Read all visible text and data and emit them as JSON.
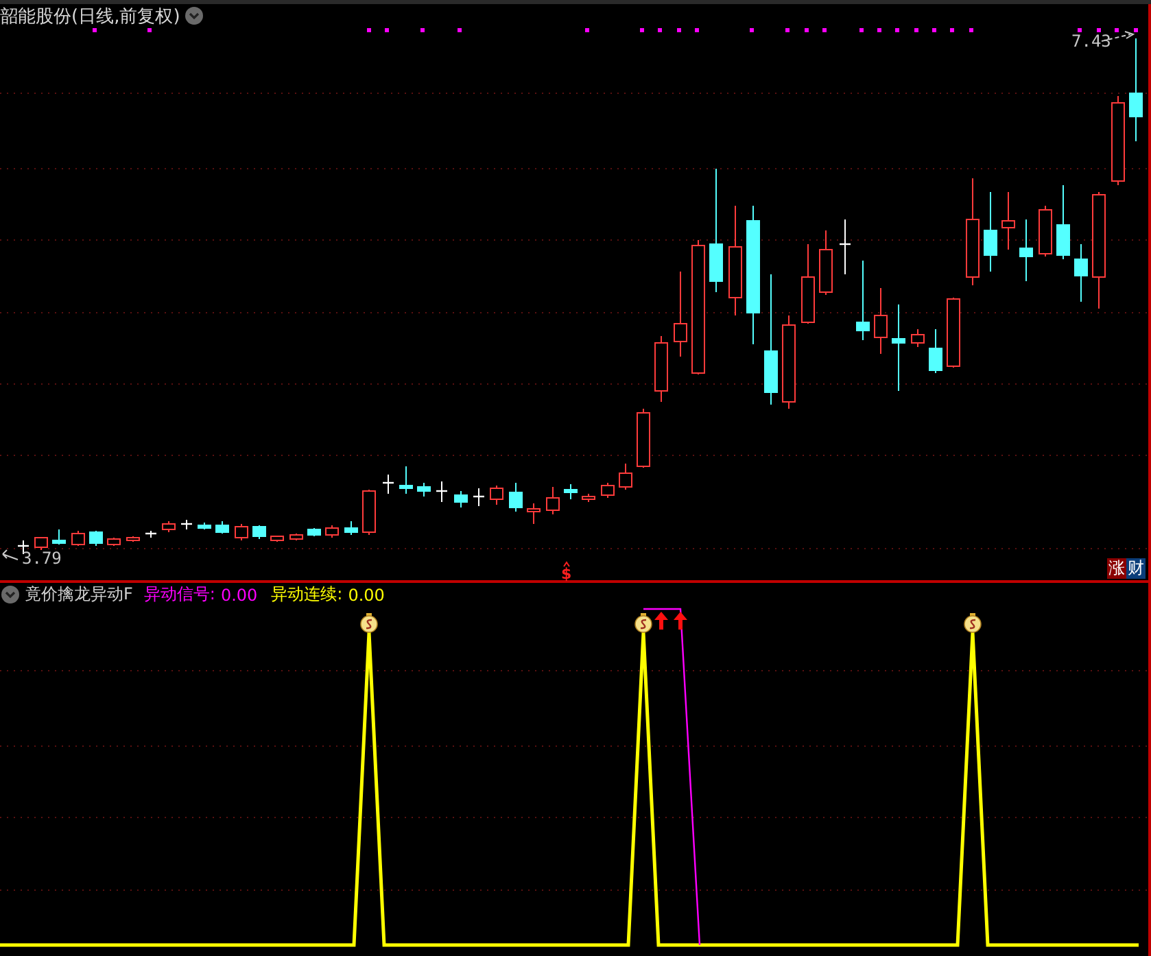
{
  "header": {
    "title": "韶能股份(日线,前复权)"
  },
  "price_labels": {
    "high": "7.43",
    "low": "3.79"
  },
  "signal_mark": "$",
  "badges": [
    {
      "text": "涨",
      "color": "#8b0000"
    },
    {
      "text": "财",
      "color": "#0b3e7a"
    }
  ],
  "indicator": {
    "name": "竟价擒龙异动F",
    "series": [
      {
        "label": "异动信号:",
        "value": "0.00",
        "color": "#ff00ff"
      },
      {
        "label": "异动连续:",
        "value": "0.00",
        "color": "#ffff00"
      }
    ]
  }
}
